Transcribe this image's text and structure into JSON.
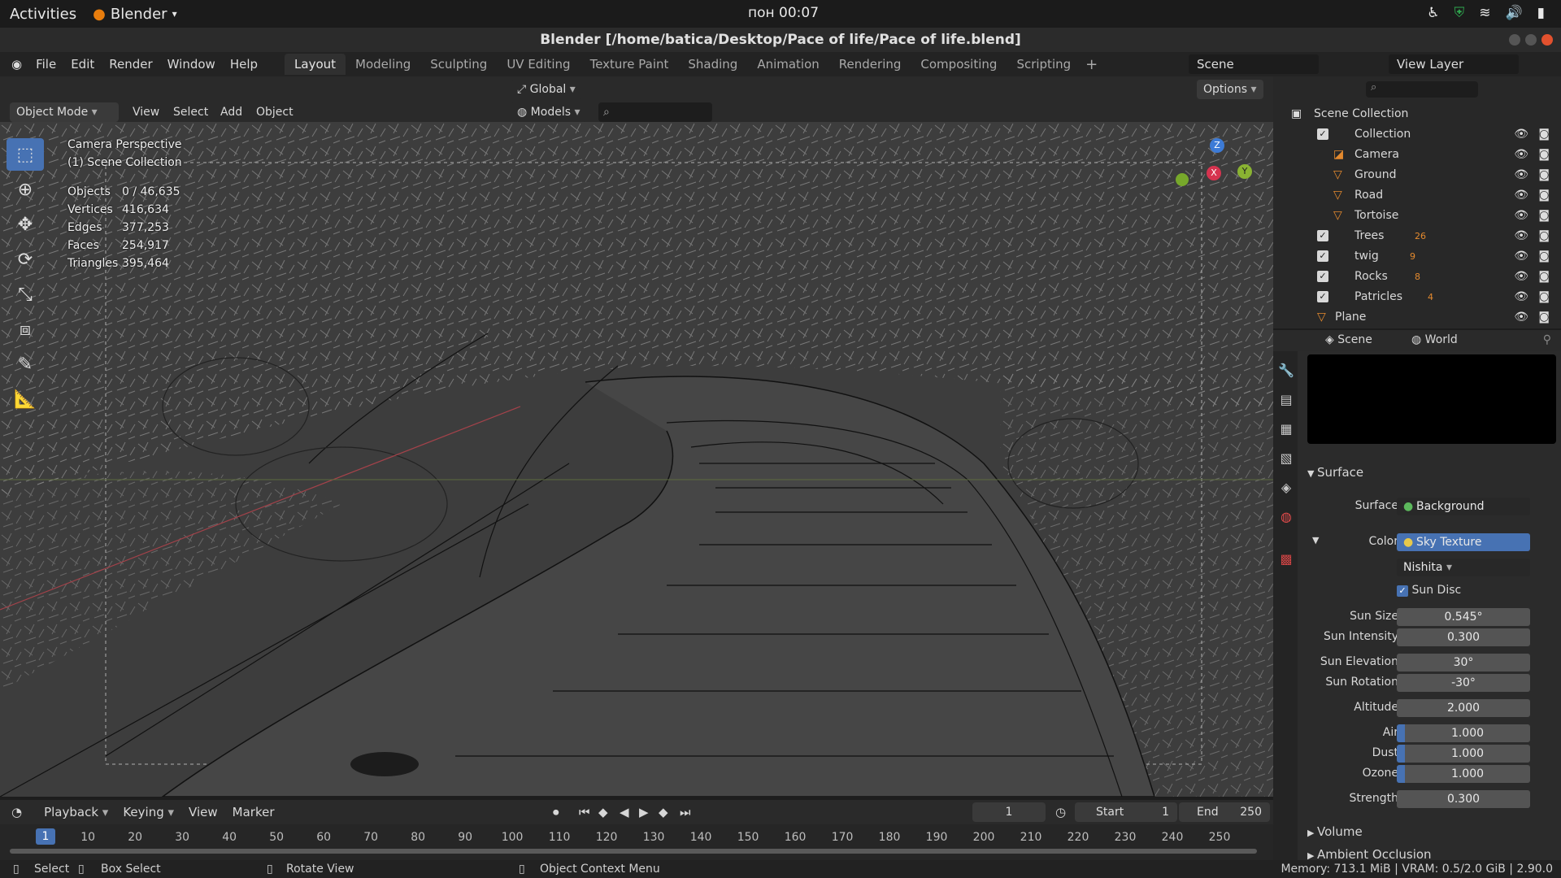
{
  "gnome": {
    "activities": "Activities",
    "app": "Blender",
    "clock": "пон 00:07"
  },
  "window": {
    "title": "Blender [/home/batica/Desktop/Pace of life/Pace of life.blend]"
  },
  "menu": [
    "File",
    "Edit",
    "Render",
    "Window",
    "Help"
  ],
  "workspaces": [
    "Layout",
    "Modeling",
    "Sculpting",
    "UV Editing",
    "Texture Paint",
    "Shading",
    "Animation",
    "Rendering",
    "Compositing",
    "Scripting"
  ],
  "scene_name": "Scene",
  "view_layer": "View Layer",
  "viewport_header": {
    "orientation": "Global",
    "options": "Options",
    "mode": "Object Mode",
    "view": "View",
    "select": "Select",
    "add": "Add",
    "object": "Object",
    "collection_filter": "Models"
  },
  "overlay": {
    "perspective": "Camera Perspective",
    "collection": "(1) Scene Collection",
    "stats": [
      {
        "label": "Objects",
        "value": "0 / 46,635"
      },
      {
        "label": "Vertices",
        "value": "416,634"
      },
      {
        "label": "Edges",
        "value": "377,253"
      },
      {
        "label": "Faces",
        "value": "254,917"
      },
      {
        "label": "Triangles",
        "value": "395,464"
      }
    ]
  },
  "gizmo": {
    "z": "Z",
    "y": "Y",
    "x": "X"
  },
  "outliner": {
    "root": "Scene Collection",
    "items": [
      {
        "name": "Collection",
        "kind": "collection"
      },
      {
        "name": "Camera",
        "kind": "object"
      },
      {
        "name": "Ground",
        "kind": "object"
      },
      {
        "name": "Road",
        "kind": "object"
      },
      {
        "name": "Tortoise",
        "kind": "object"
      },
      {
        "name": "Trees",
        "kind": "collection",
        "badge": "26"
      },
      {
        "name": "twig",
        "kind": "collection",
        "badge": "9"
      },
      {
        "name": "Rocks",
        "kind": "collection",
        "badge": "8"
      },
      {
        "name": "Patricles",
        "kind": "collection",
        "badge": "4"
      },
      {
        "name": "Plane",
        "kind": "object"
      }
    ]
  },
  "properties": {
    "scene_tab": "Scene",
    "world_tab": "World",
    "surface_panel": "Surface",
    "surface_label": "Surface",
    "surface_value": "Background",
    "color_label": "Color",
    "color_value": "Sky Texture",
    "sky_type": "Nishita",
    "sun_disc": "Sun Disc",
    "fields": [
      {
        "label": "Sun Size",
        "value": "0.545°"
      },
      {
        "label": "Sun Intensity",
        "value": "0.300"
      },
      {
        "label": "Sun Elevation",
        "value": "30°"
      },
      {
        "label": "Sun Rotation",
        "value": "-30°"
      },
      {
        "label": "Altitude",
        "value": "2.000"
      },
      {
        "label": "Air",
        "value": "1.000"
      },
      {
        "label": "Dust",
        "value": "1.000"
      },
      {
        "label": "Ozone",
        "value": "1.000"
      },
      {
        "label": "Strength",
        "value": "0.300"
      }
    ],
    "volume_panel": "Volume",
    "ao_panel": "Ambient Occlusion"
  },
  "timeline": {
    "playback": "Playback",
    "keying": "Keying",
    "view": "View",
    "marker": "Marker",
    "current": "1",
    "start_label": "Start",
    "start": "1",
    "end_label": "End",
    "end": "250",
    "ticks": [
      "1",
      "10",
      "20",
      "30",
      "40",
      "50",
      "60",
      "70",
      "80",
      "90",
      "100",
      "110",
      "120",
      "130",
      "140",
      "150",
      "160",
      "170",
      "180",
      "190",
      "200",
      "210",
      "220",
      "230",
      "240",
      "250"
    ]
  },
  "status": {
    "select": "Select",
    "box_select": "Box Select",
    "rotate": "Rotate View",
    "context": "Object Context Menu",
    "memory": "Memory: 713.1 MiB | VRAM: 0.5/2.0 GiB | 2.90.0"
  }
}
